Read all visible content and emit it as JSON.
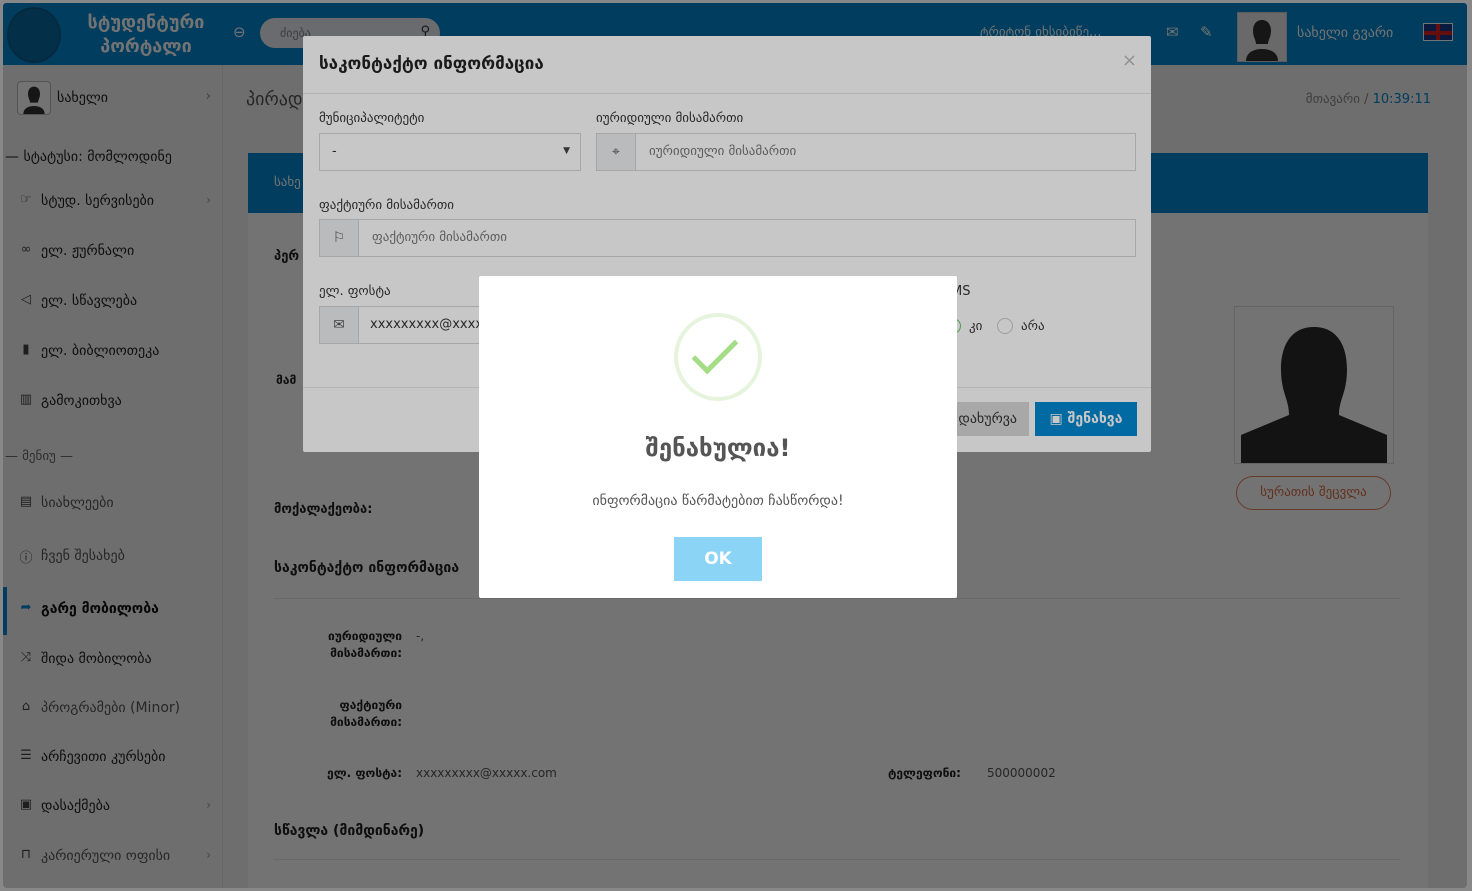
{
  "header": {
    "logo_line1": "სტუდენტური",
    "logo_line2": "პორტალი",
    "search_placeholder": "ძიება",
    "top_text": "ტრიტონ იხსიბიწე...",
    "user_name": "სახელი გვარი"
  },
  "sidebar": {
    "user": "სახელი",
    "status": "— სტატუსი: მომლოდინე",
    "menu_sep": "— მენიუ —",
    "items": [
      {
        "label": "სტუდ. სერვისები",
        "icon": "hand-icon"
      },
      {
        "label": "ელ. ჟურნალი",
        "icon": "link-icon"
      },
      {
        "label": "ელ. სწავლება",
        "icon": "megaphone-icon"
      },
      {
        "label": "ელ. ბიბლიოთეკა",
        "icon": "book-icon"
      },
      {
        "label": "გამოკითხვა",
        "icon": "bar-chart-icon"
      }
    ],
    "menu": [
      {
        "label": "სიახლეები",
        "icon": "clipboard-icon"
      },
      {
        "label": "ჩვენ შესახებ",
        "icon": "info-icon"
      },
      {
        "label": "გარე მობილობა",
        "icon": "share-icon"
      },
      {
        "label": "შიდა მობილობა",
        "icon": "shuffle-icon"
      },
      {
        "label": "პროგრამები (Minor)",
        "icon": "graduation-icon"
      },
      {
        "label": "არჩევითი კურსები",
        "icon": "database-icon"
      },
      {
        "label": "დასაქმება",
        "icon": "briefcase-icon"
      },
      {
        "label": "კარიერული ოფისი",
        "icon": "desk-icon"
      }
    ]
  },
  "content": {
    "page_title": "პირად",
    "breadcrumb_home": "მთავარი",
    "time": "10:39:11",
    "card_head": "სახე",
    "section_personal": "პერ",
    "father_label": "მამ",
    "citizenship_label": "მოქალაქეობა:",
    "contact_title": "საკონტაქტო ინფორმაცია",
    "legal_address_label": "იურიდიული მისამართი:",
    "legal_address_value": "-,",
    "actual_address_label": "ფაქტიური მისამართი:",
    "email_label": "ელ. ფოსტა:",
    "email_value": "xxxxxxxxx@xxxxx.com",
    "phone_label": "ტელეფონი:",
    "phone_value": "500000002",
    "study_title": "სწავლა (მიმდინარე)",
    "change_photo": "სურათის შეცვლა"
  },
  "modal": {
    "title": "საკონტაქტო ინფორმაცია",
    "close": "×",
    "municipality_label": "მუნიციპალიტეტი",
    "municipality_value": "-",
    "legal_label": "იურიდიული მისამართი",
    "legal_placeholder": "იურიდიული მისამართი",
    "actual_label": "ფაქტიური მისამართი",
    "actual_placeholder": "ფაქტიური მისამართი",
    "email_label": "ელ. ფოსტა",
    "email_value": "xxxxxxxxx@xxxxx.com",
    "sms_label": "MS",
    "radio_yes": "კი",
    "radio_no": "არა",
    "btn_close": "დახურვა",
    "btn_save": "შენახვა"
  },
  "alert": {
    "title": "შენახულია!",
    "message": "ინფორმაცია წარმატებით ჩასწორდა!",
    "ok": "OK",
    "success_color": "#a5dc86",
    "ok_color": "#8cd4f5"
  }
}
